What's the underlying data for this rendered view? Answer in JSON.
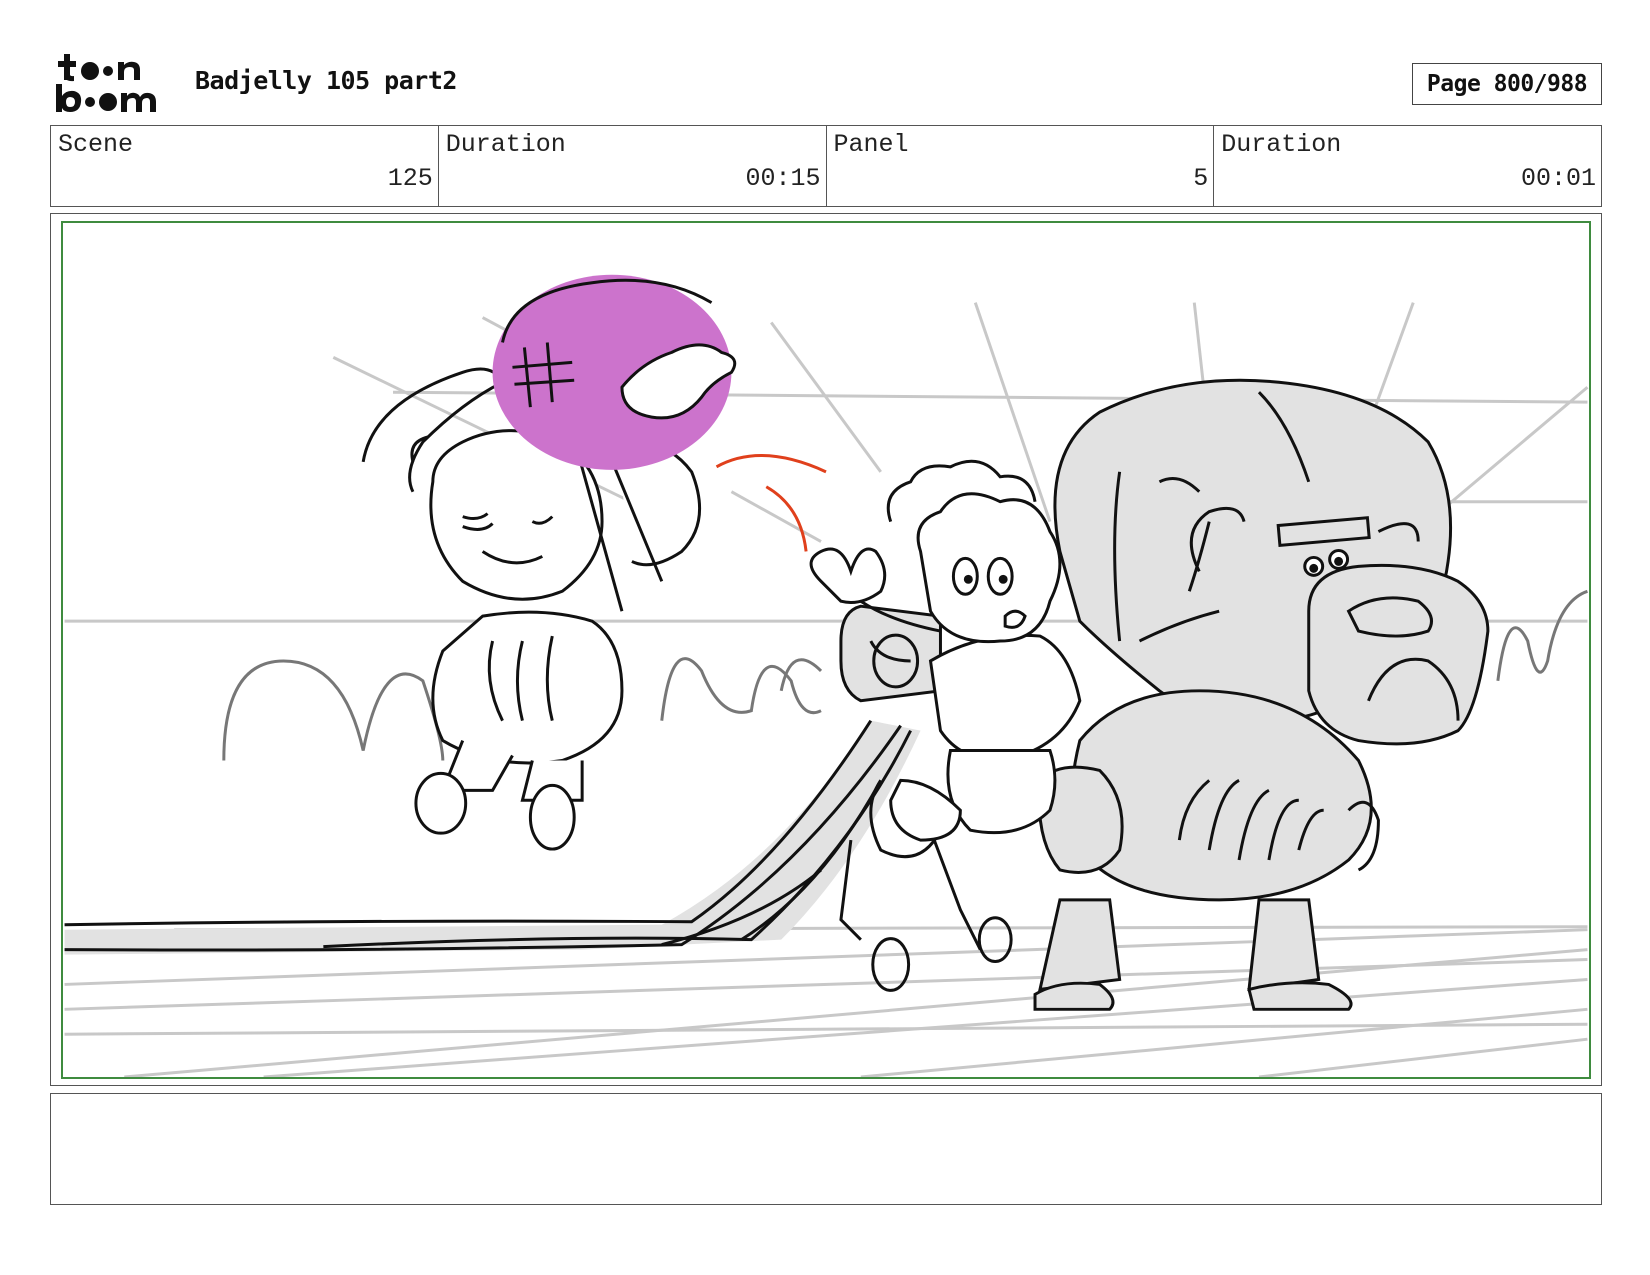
{
  "header": {
    "logo_text": "toon boom",
    "project_title": "Badjelly 105 part2",
    "page_indicator": "Page 800/988"
  },
  "info": {
    "scene_label": "Scene",
    "scene_value": "125",
    "scene_duration_label": "Duration",
    "scene_duration_value": "00:15",
    "panel_label": "Panel",
    "panel_value": "5",
    "panel_duration_label": "Duration",
    "panel_duration_value": "00:01"
  },
  "panel": {
    "border_color": "#3f8b3f",
    "ball_color": "#cc73cc",
    "accent_color": "#e0401c",
    "fill_gray": "#e2e2e2"
  },
  "notes": {
    "text": ""
  }
}
